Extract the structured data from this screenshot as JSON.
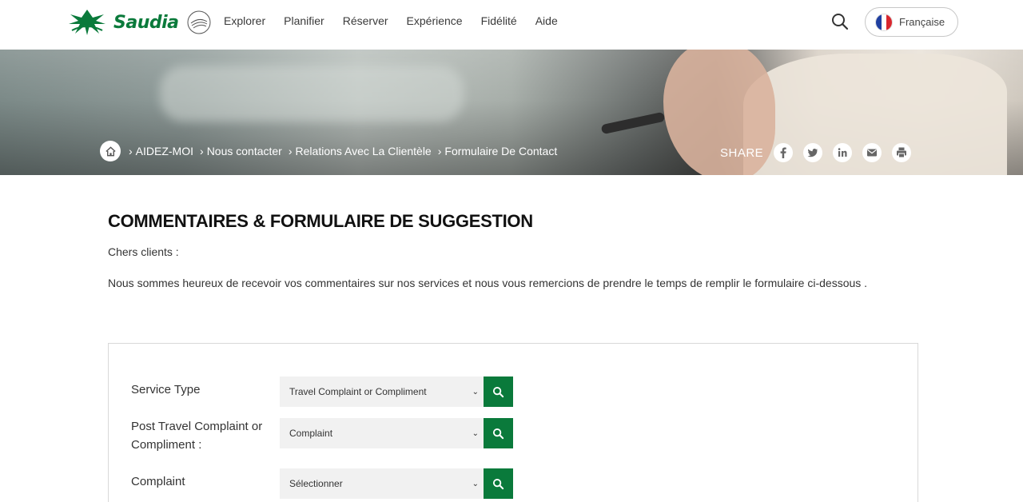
{
  "header": {
    "brand": "Saudia",
    "nav": [
      "Explorer",
      "Planifier",
      "Réserver",
      "Expérience",
      "Fidélité",
      "Aide"
    ],
    "language": "Française"
  },
  "hero": {
    "breadcrumb": [
      "AIDEZ-MOI",
      "Nous contacter",
      "Relations Avec La Clientèle",
      "Formulaire De Contact"
    ],
    "share_label": "SHARE"
  },
  "content": {
    "title": "COMMENTAIRES & FORMULAIRE DE SUGGESTION",
    "greeting": "Chers clients :",
    "intro": "Nous sommes heureux de recevoir vos commentaires sur nos services et nous vous remercions de prendre le temps de remplir le formulaire ci-dessous ."
  },
  "form": {
    "rows": [
      {
        "label": "Service Type",
        "value": "Travel Complaint or Compliment"
      },
      {
        "label": "Post Travel Complaint or Compliment :",
        "value": "Complaint"
      },
      {
        "label": "Complaint",
        "value": "Sélectionner"
      }
    ]
  },
  "colors": {
    "brand_green": "#0a7a3b"
  }
}
